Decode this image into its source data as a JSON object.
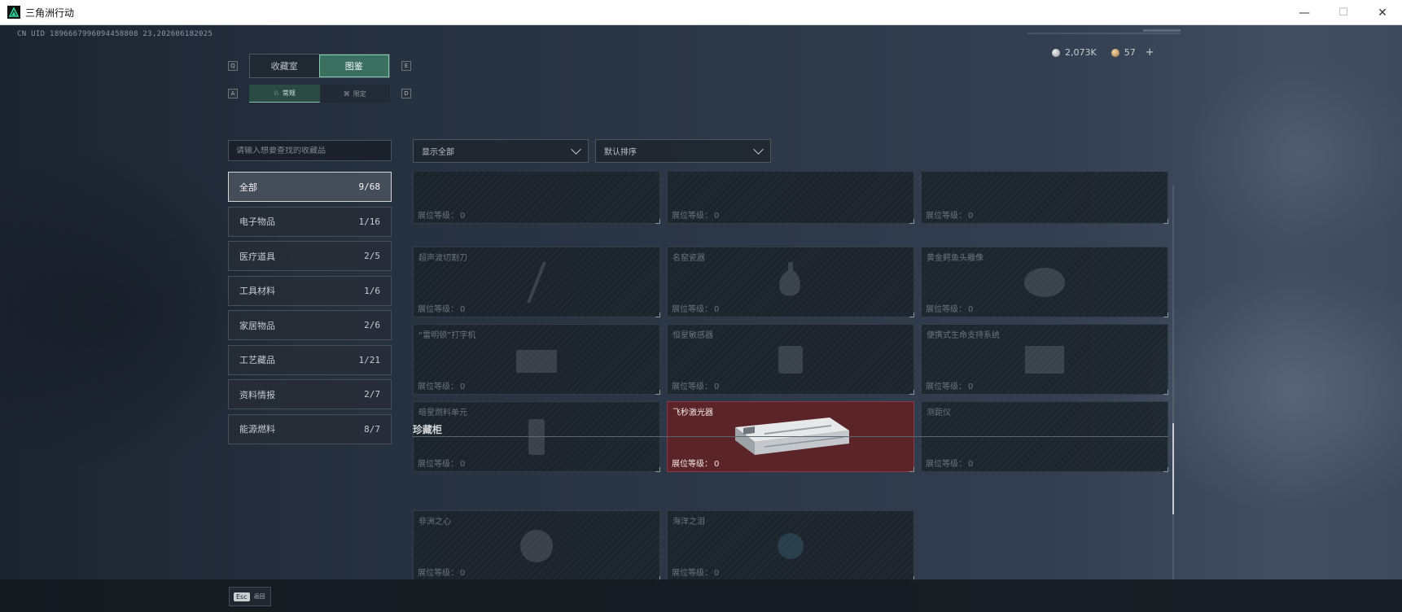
{
  "window": {
    "title": "三角洲行动",
    "minimize": "—",
    "maximize": "☐",
    "close": "✕"
  },
  "uid": "CN UID 1896667996094458808 23,202606182025",
  "currency": {
    "coin": "2,073K",
    "gold": "57",
    "plus": "+"
  },
  "tabs": {
    "left_key": "Q",
    "right_key": "E",
    "items": [
      "收藏室",
      "图鉴"
    ],
    "active": 1
  },
  "subtabs": {
    "left_key": "A",
    "right_key": "D",
    "items": [
      "常规",
      "限定"
    ],
    "active": 0
  },
  "search": {
    "placeholder": "请输入想要查找的收藏品"
  },
  "categories": [
    {
      "label": "全部",
      "count": "9/68",
      "active": true
    },
    {
      "label": "电子物品",
      "count": "1/16"
    },
    {
      "label": "医疗道具",
      "count": "2/5"
    },
    {
      "label": "工具材料",
      "count": "1/6"
    },
    {
      "label": "家居物品",
      "count": "2/6"
    },
    {
      "label": "工艺藏品",
      "count": "1/21"
    },
    {
      "label": "资料情报",
      "count": "2/7"
    },
    {
      "label": "能源燃料",
      "count": "8/7"
    }
  ],
  "filters": {
    "display": "显示全部",
    "sort": "默认排序"
  },
  "level_label": "展位等级：",
  "items": [
    {
      "name": "",
      "level": "0"
    },
    {
      "name": "",
      "level": "0"
    },
    {
      "name": "",
      "level": "0"
    },
    {
      "name": "超声波切割刀",
      "level": "0"
    },
    {
      "name": "名窑瓷器",
      "level": "0"
    },
    {
      "name": "黄金鳄鱼头雕像",
      "level": "0"
    },
    {
      "name": "“雷明顿”打字机",
      "level": "0"
    },
    {
      "name": "恒星敏感器",
      "level": "0"
    },
    {
      "name": "便携式生命支持系统",
      "level": "0"
    },
    {
      "name": "暗星燃料单元",
      "level": "0"
    },
    {
      "name": "飞秒激光器",
      "level": "0",
      "selected": true
    },
    {
      "name": "测距仪",
      "level": "0"
    }
  ],
  "treasure": {
    "title": "珍藏柜",
    "items": [
      {
        "name": "非洲之心",
        "level": "0"
      },
      {
        "name": "海洋之泪",
        "level": "0"
      }
    ]
  },
  "footer": {
    "key": "Esc",
    "label": "返回"
  }
}
